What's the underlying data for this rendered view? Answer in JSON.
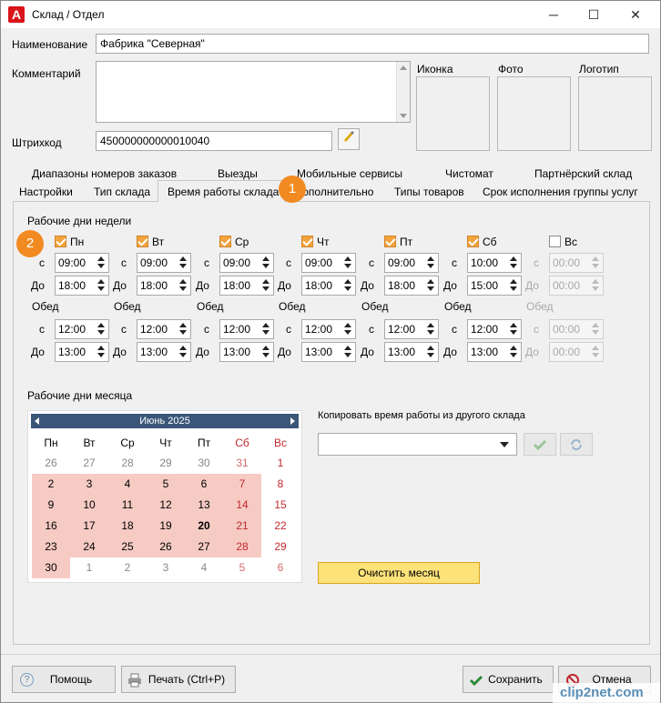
{
  "window": {
    "title": "Склад / Отдел",
    "minimize": "─",
    "maximize": "☐",
    "close": "✕"
  },
  "form": {
    "name_label": "Наименование",
    "name_value": "Фабрика \"Северная\"",
    "comment_label": "Комментарий",
    "barcode_label": "Штрихкод",
    "barcode_value": "450000000000010040",
    "icon_label": "Иконка",
    "photo_label": "Фото",
    "logo_label": "Логотип"
  },
  "tabs_row1": [
    "Диапазоны номеров заказов",
    "Выезды",
    "Мобильные сервисы",
    "Чистомат",
    "Партнёрский склад"
  ],
  "tabs_row2": [
    "Настройки",
    "Тип склада",
    "Время работы склада",
    "Дополнительно",
    "Типы товаров",
    "Срок исполнения группы услуг"
  ],
  "week": {
    "section_label": "Рабочие дни недели",
    "from_label": "с",
    "to_label": "До",
    "lunch_label": "Обед",
    "days": [
      {
        "name": "Пн",
        "checked": true,
        "from": "09:00",
        "to": "18:00",
        "lunch_from": "12:00",
        "lunch_to": "13:00"
      },
      {
        "name": "Вт",
        "checked": true,
        "from": "09:00",
        "to": "18:00",
        "lunch_from": "12:00",
        "lunch_to": "13:00"
      },
      {
        "name": "Ср",
        "checked": true,
        "from": "09:00",
        "to": "18:00",
        "lunch_from": "12:00",
        "lunch_to": "13:00"
      },
      {
        "name": "Чт",
        "checked": true,
        "from": "09:00",
        "to": "18:00",
        "lunch_from": "12:00",
        "lunch_to": "13:00"
      },
      {
        "name": "Пт",
        "checked": true,
        "from": "09:00",
        "to": "18:00",
        "lunch_from": "12:00",
        "lunch_to": "13:00"
      },
      {
        "name": "Сб",
        "checked": true,
        "from": "10:00",
        "to": "15:00",
        "lunch_from": "12:00",
        "lunch_to": "13:00"
      },
      {
        "name": "Вс",
        "checked": false,
        "from": "00:00",
        "to": "00:00",
        "lunch_from": "00:00",
        "lunch_to": "00:00"
      }
    ]
  },
  "month": {
    "section_label": "Рабочие дни месяца",
    "month_title": "Июнь 2025",
    "weekdays": [
      "Пн",
      "Вт",
      "Ср",
      "Чт",
      "Пт",
      "Сб",
      "Вс"
    ],
    "rows": [
      [
        {
          "d": "26",
          "o": true
        },
        {
          "d": "27",
          "o": true
        },
        {
          "d": "28",
          "o": true
        },
        {
          "d": "29",
          "o": true
        },
        {
          "d": "30",
          "o": true
        },
        {
          "d": "31",
          "o": true,
          "r": true
        },
        {
          "d": "1",
          "r": true
        }
      ],
      [
        {
          "d": "2",
          "w": true
        },
        {
          "d": "3",
          "w": true
        },
        {
          "d": "4",
          "w": true
        },
        {
          "d": "5",
          "w": true
        },
        {
          "d": "6",
          "w": true
        },
        {
          "d": "7",
          "w": true,
          "r": true
        },
        {
          "d": "8",
          "r": true
        }
      ],
      [
        {
          "d": "9",
          "w": true
        },
        {
          "d": "10",
          "w": true
        },
        {
          "d": "11",
          "w": true
        },
        {
          "d": "12",
          "w": true
        },
        {
          "d": "13",
          "w": true
        },
        {
          "d": "14",
          "w": true,
          "r": true
        },
        {
          "d": "15",
          "r": true
        }
      ],
      [
        {
          "d": "16",
          "w": true
        },
        {
          "d": "17",
          "w": true
        },
        {
          "d": "18",
          "w": true
        },
        {
          "d": "19",
          "w": true
        },
        {
          "d": "20",
          "w": true,
          "b": true
        },
        {
          "d": "21",
          "w": true,
          "r": true
        },
        {
          "d": "22",
          "r": true
        }
      ],
      [
        {
          "d": "23",
          "w": true
        },
        {
          "d": "24",
          "w": true
        },
        {
          "d": "25",
          "w": true
        },
        {
          "d": "26",
          "w": true
        },
        {
          "d": "27",
          "w": true
        },
        {
          "d": "28",
          "w": true,
          "r": true
        },
        {
          "d": "29",
          "r": true
        }
      ],
      [
        {
          "d": "30",
          "w": true
        },
        {
          "d": "1",
          "o": true
        },
        {
          "d": "2",
          "o": true
        },
        {
          "d": "3",
          "o": true
        },
        {
          "d": "4",
          "o": true
        },
        {
          "d": "5",
          "o": true,
          "r": true
        },
        {
          "d": "6",
          "o": true,
          "r": true
        }
      ]
    ]
  },
  "copy": {
    "label": "Копировать время работы из другого склада",
    "clear_button": "Очистить месяц"
  },
  "footer": {
    "help": "Помощь",
    "print": "Печать (Ctrl+P)",
    "save": "Сохранить",
    "cancel": "Отмена"
  },
  "badges": [
    "1",
    "2"
  ],
  "watermark": "clip2net.com",
  "colors": {
    "accent": "#f2a33c",
    "workday": "#f6cbc4",
    "weekend_text": "#c0282d",
    "calendar_header": "#3a5678"
  }
}
